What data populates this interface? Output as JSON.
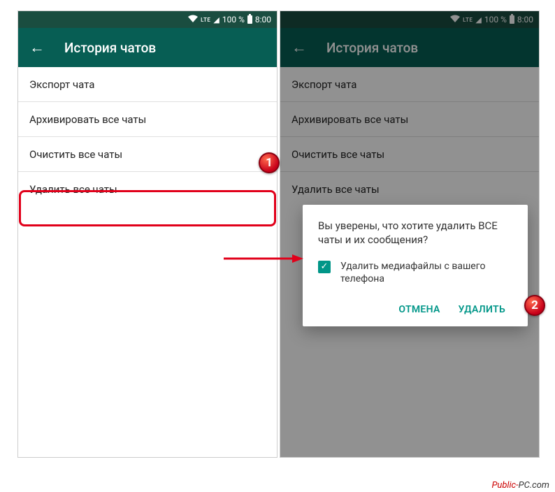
{
  "status": {
    "lte": "LTE",
    "percent": "100 %",
    "time": "8:00"
  },
  "appbar": {
    "title": "История чатов"
  },
  "menu": {
    "export": "Экспорт чата",
    "archive": "Архивировать все чаты",
    "clear": "Очистить все чаты",
    "delete": "Удалить все чаты"
  },
  "dialog": {
    "message": "Вы уверены, что хотите удалить ВСЕ чаты и их сообщения?",
    "checkbox_label": "Удалить медиафайлы с вашего телефона",
    "cancel": "ОТМЕНА",
    "delete": "УДАЛИТЬ"
  },
  "badges": {
    "one": "1",
    "two": "2"
  },
  "watermark": {
    "a": "Public-",
    "b": "PC.com"
  }
}
